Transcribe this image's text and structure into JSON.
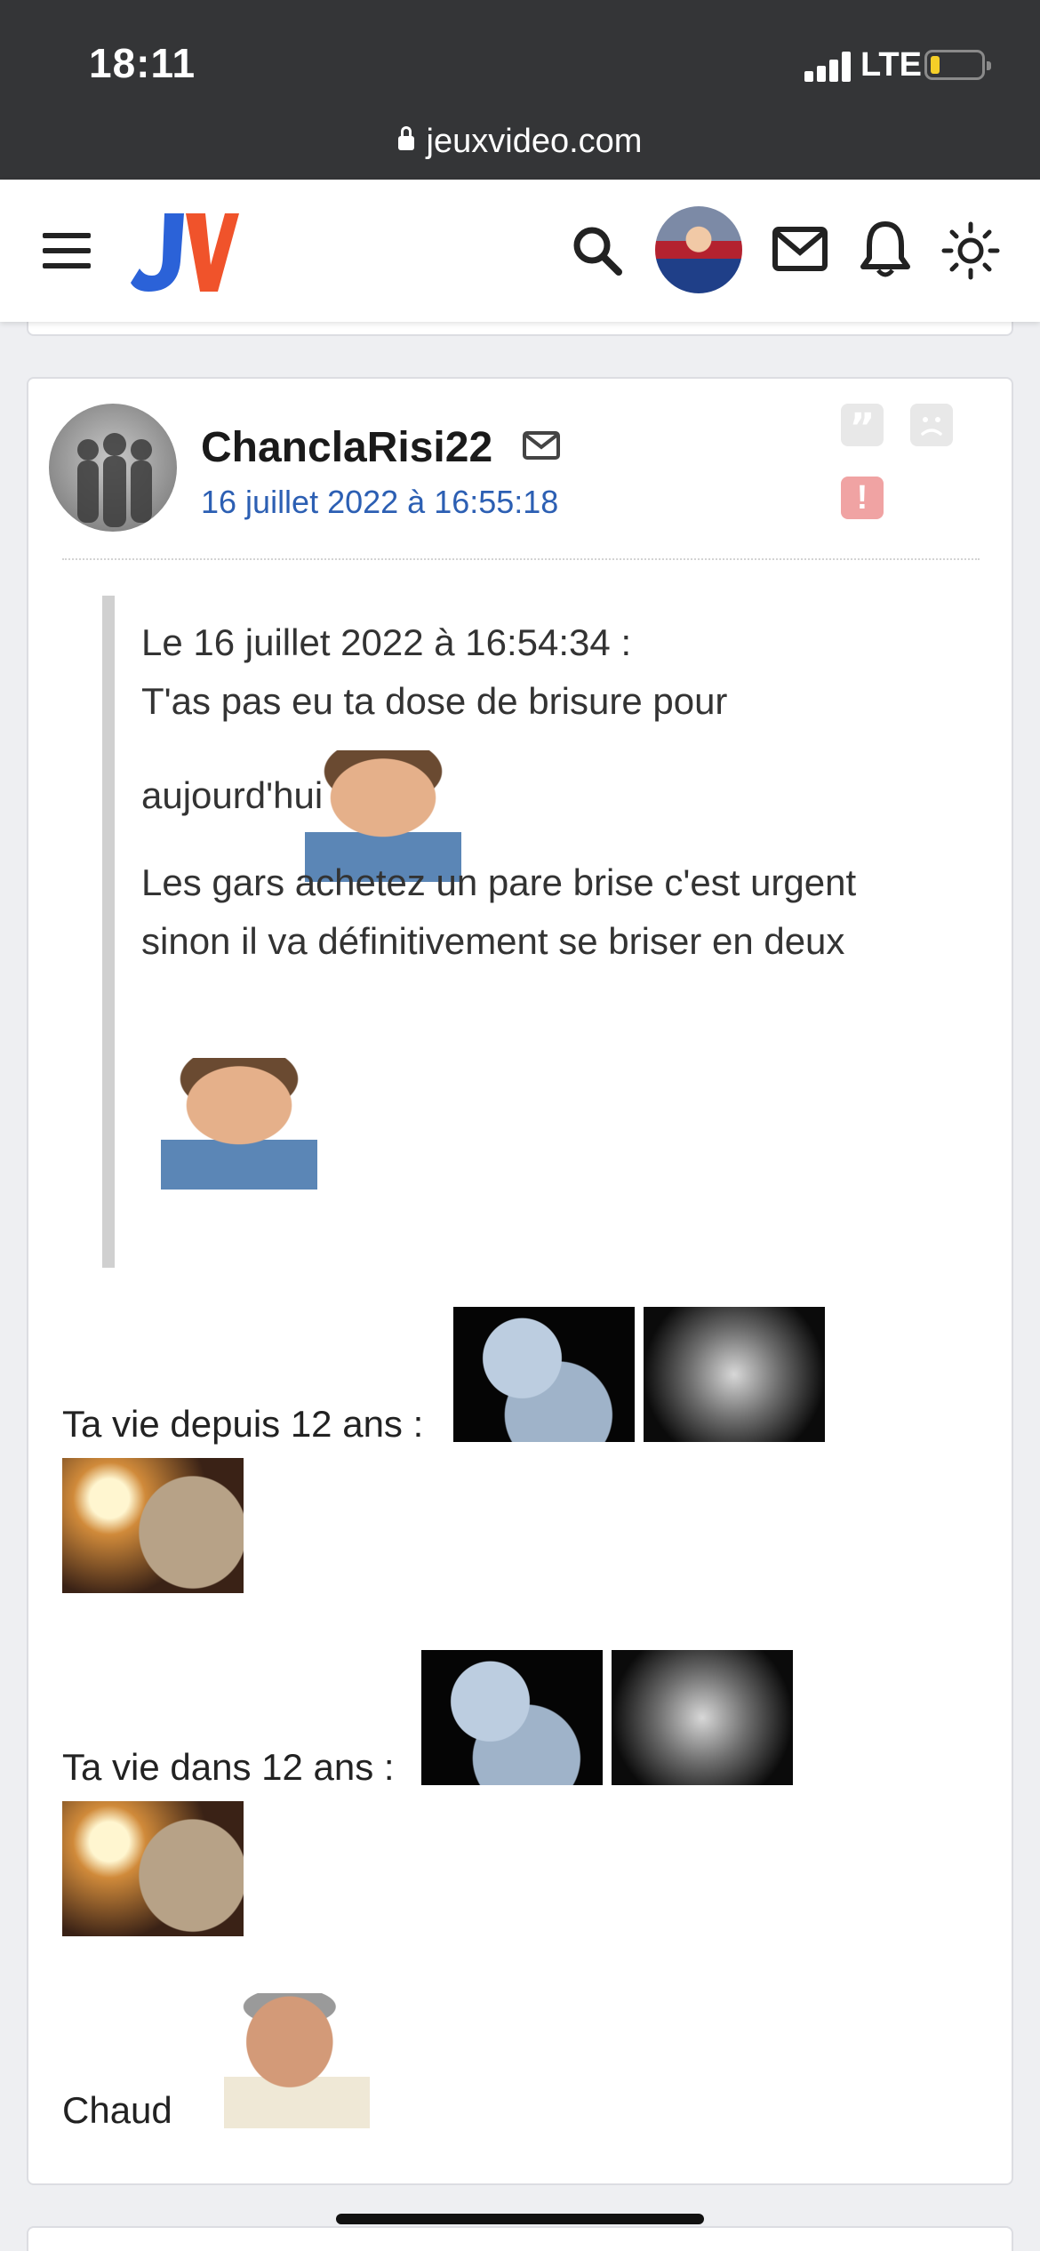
{
  "status_bar": {
    "time": "18:11",
    "network": "LTE",
    "url": "jeuxvideo.com"
  },
  "header": {
    "logo_text": "JV",
    "logo_colors": {
      "j": "#2b62d8",
      "v": "#f0532b"
    }
  },
  "post": {
    "author": "ChanclaRisi22",
    "date": "16 juillet 2022 à 16:55:18",
    "quote_mark": "”",
    "alert_mark": "!",
    "quote": {
      "header": "Le 16 juillet 2022 à 16:54:34 :",
      "line1": "T'as pas eu ta dose de brisure pour",
      "line2": "aujourd'hui ?",
      "line3": "Les gars achetez un pare brise c'est urgent",
      "line4": "sinon il va définitivement se briser en deux"
    },
    "body": {
      "line1": "Ta vie depuis 12 ans :",
      "line2": "Ta vie dans 12 ans :",
      "line3": "Chaud"
    }
  },
  "colors": {
    "date_link": "#2c5fb3",
    "alert": "#f0a3a3"
  }
}
